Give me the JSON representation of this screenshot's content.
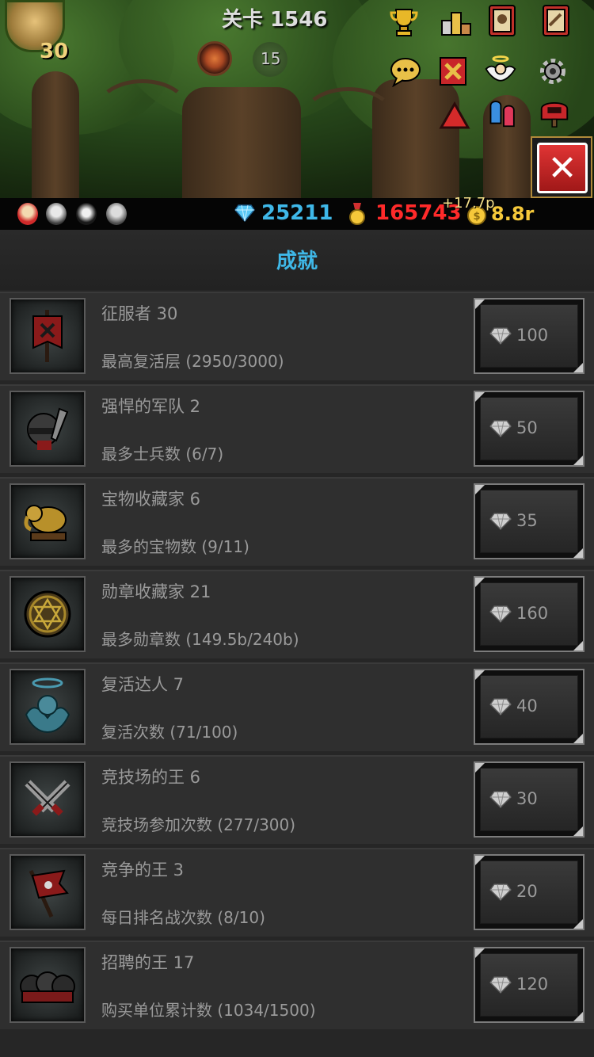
{
  "scene": {
    "stage_title": "关卡 1546",
    "hero_level": "30",
    "orb_counter": "15"
  },
  "toolbar": {
    "icons": [
      "trophy-icon",
      "podium-icon",
      "hero-book-icon",
      "quest-book-icon",
      "chat-icon",
      "battle-flag-icon",
      "angel-icon",
      "settings-icon",
      "warning-icon",
      "party-icon",
      "mailbox-icon"
    ]
  },
  "resources": {
    "diamonds": "25211",
    "medals": "165743",
    "bonus": "+17.7p",
    "gold": "8.8r",
    "colors": {
      "diamonds": "#3fb8e8",
      "medals": "#ff2a2a",
      "gold": "#f5c83a"
    }
  },
  "panel": {
    "title": "成就",
    "achievements": [
      {
        "icon": "banner-icon",
        "name": "征服者 30",
        "desc": "最高复活层 (2950/3000)",
        "reward": "100"
      },
      {
        "icon": "soldier-icon",
        "name": "强悍的军队 2",
        "desc": "最多士兵数 (6/7)",
        "reward": "50"
      },
      {
        "icon": "elephant-treasure-icon",
        "name": "宝物收藏家 6",
        "desc": "最多的宝物数 (9/11)",
        "reward": "35"
      },
      {
        "icon": "medal-star-icon",
        "name": "勋章收藏家 21",
        "desc": "最多勋章数 (149.5b/240b)",
        "reward": "160"
      },
      {
        "icon": "halo-spirit-icon",
        "name": "复活达人 7",
        "desc": "复活次数 (71/100)",
        "reward": "40"
      },
      {
        "icon": "crossed-swords-icon",
        "name": "竞技场的王 6",
        "desc": "竞技场参加次数 (277/300)",
        "reward": "30"
      },
      {
        "icon": "war-flag-icon",
        "name": "竞争的王 3",
        "desc": "每日排名战次数 (8/10)",
        "reward": "20"
      },
      {
        "icon": "recruits-icon",
        "name": "招聘的王 17",
        "desc": "购买单位累计数 (1034/1500)",
        "reward": "120"
      }
    ]
  }
}
